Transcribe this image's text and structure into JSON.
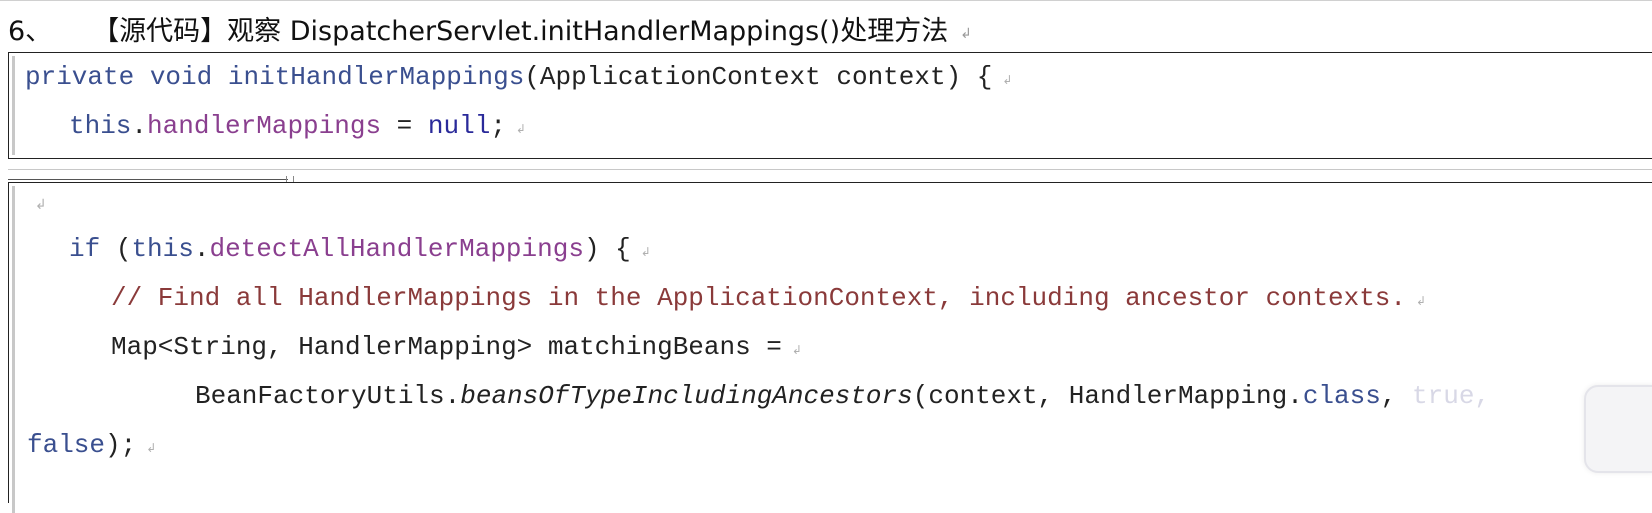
{
  "heading": {
    "number": "6、",
    "title": "【源代码】观察 DispatcherServlet.initHandlerMappings()处理方法",
    "para_mark": "↲"
  },
  "code": {
    "block1": {
      "line1": {
        "kw1": "private",
        "kw2": "void",
        "method": "initHandlerMappings",
        "params": "(ApplicationContext context) {"
      },
      "line2": {
        "this": "this",
        "dot": ".",
        "field": "handlerMappings",
        "assign": " = ",
        "null": "null",
        "end": ";"
      }
    },
    "block2": {
      "empty_mark": "↲",
      "line_if": {
        "kw": "if",
        "open": " (",
        "this": "this",
        "dot": ".",
        "field": "detectAllHandlerMappings",
        "close": ") {"
      },
      "comment": "// Find all HandlerMappings in the ApplicationContext, including ancestor contexts.",
      "map_line": "Map<String, HandlerMapping> matchingBeans =",
      "call_line": {
        "prefix": "BeanFactoryUtils.",
        "method": "beansOfTypeIncludingAncestors",
        "args": "(context, HandlerMapping.",
        "class_kw": "class",
        "comma": ", ",
        "true_kw": "true,"
      },
      "false_line": {
        "kw": "false",
        "end": ");"
      }
    },
    "para_mark": "↲"
  },
  "colors": {
    "keyword": "#3a4f8f",
    "field": "#8a3f8f",
    "comment": "#8a3a3a",
    "text": "#222222"
  },
  "icons": {
    "video_badge": "video-player-badge-icon"
  }
}
